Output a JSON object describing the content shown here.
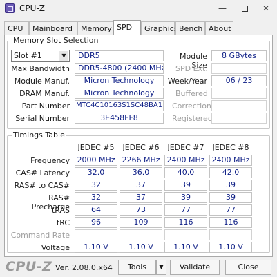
{
  "window": {
    "title": "CPU-Z"
  },
  "tabs": [
    {
      "label": "CPU"
    },
    {
      "label": "Mainboard"
    },
    {
      "label": "Memory"
    },
    {
      "label": "SPD"
    },
    {
      "label": "Graphics"
    },
    {
      "label": "Bench"
    },
    {
      "label": "About"
    }
  ],
  "active_tab": "SPD",
  "memory_slot": {
    "title": "Memory Slot Selection",
    "slot_value": "Slot #1",
    "type": "DDR5",
    "module_size_label": "Module Size",
    "module_size": "8 GBytes",
    "max_bandwidth_label": "Max Bandwidth",
    "max_bandwidth": "DDR5-4800 (2400 MHz)",
    "spd_ext_label": "SPD Ext.",
    "module_manuf_label": "Module Manuf.",
    "module_manuf": "Micron Technology",
    "week_year_label": "Week/Year",
    "week_year": "06 / 23",
    "dram_manuf_label": "DRAM Manuf.",
    "dram_manuf": "Micron Technology",
    "buffered_label": "Buffered",
    "part_number_label": "Part Number",
    "part_number": "MTC4C10163S1SC48BA1",
    "correction_label": "Correction",
    "serial_number_label": "Serial Number",
    "serial_number": "3E458FF8",
    "registered_label": "Registered"
  },
  "timings": {
    "title": "Timings Table",
    "columns": [
      "JEDEC #5",
      "JEDEC #6",
      "JEDEC #7",
      "JEDEC #8"
    ],
    "rows": [
      {
        "label": "Frequency",
        "values": [
          "2000 MHz",
          "2266 MHz",
          "2400 MHz",
          "2400 MHz"
        ]
      },
      {
        "label": "CAS# Latency",
        "values": [
          "32.0",
          "36.0",
          "40.0",
          "42.0"
        ]
      },
      {
        "label": "RAS# to CAS#",
        "values": [
          "32",
          "37",
          "39",
          "39"
        ]
      },
      {
        "label": "RAS# Precharge",
        "values": [
          "32",
          "37",
          "39",
          "39"
        ]
      },
      {
        "label": "tRAS",
        "values": [
          "64",
          "73",
          "77",
          "77"
        ]
      },
      {
        "label": "tRC",
        "values": [
          "96",
          "109",
          "116",
          "116"
        ]
      },
      {
        "label": "Command Rate",
        "values": [
          "",
          "",
          "",
          ""
        ]
      },
      {
        "label": "Voltage",
        "values": [
          "1.10 V",
          "1.10 V",
          "1.10 V",
          "1.10 V"
        ]
      }
    ]
  },
  "footer": {
    "brand": "CPU-Z",
    "version": "Ver. 2.08.0.x64",
    "tools_label": "Tools",
    "validate_label": "Validate",
    "close_label": "Close"
  },
  "colors": {
    "value_text": "#0e1f86",
    "panel_bg": "#ffffff",
    "window_bg": "#f0f0f0"
  }
}
